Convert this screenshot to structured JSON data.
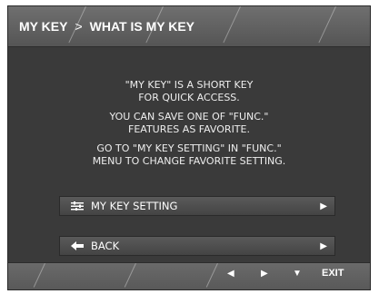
{
  "header": {
    "crumb_root": "MY KEY",
    "separator": ">",
    "crumb_current": "WHAT IS MY KEY"
  },
  "info": {
    "paragraph_1": [
      "\"MY KEY\" IS A SHORT KEY",
      "FOR QUICK ACCESS."
    ],
    "paragraph_2": [
      "YOU CAN SAVE ONE OF \"FUNC.\"",
      "FEATURES AS FAVORITE."
    ],
    "paragraph_3": [
      "GO TO \"MY KEY SETTING\" IN \"FUNC.\"",
      "MENU TO CHANGE FAVORITE SETTING."
    ]
  },
  "menu": {
    "items": [
      {
        "label": "MY KEY SETTING",
        "icon": "settings-sliders-icon"
      },
      {
        "label": "BACK",
        "icon": "back-arrow-icon"
      }
    ]
  },
  "footer": {
    "left_glyph": "◀",
    "right_glyph": "▶",
    "down_glyph": "▼",
    "exit_label": "EXIT"
  },
  "colors": {
    "panel_bg": "#3a3a3a",
    "header_bg": "#606060",
    "text": "#ffffff"
  }
}
